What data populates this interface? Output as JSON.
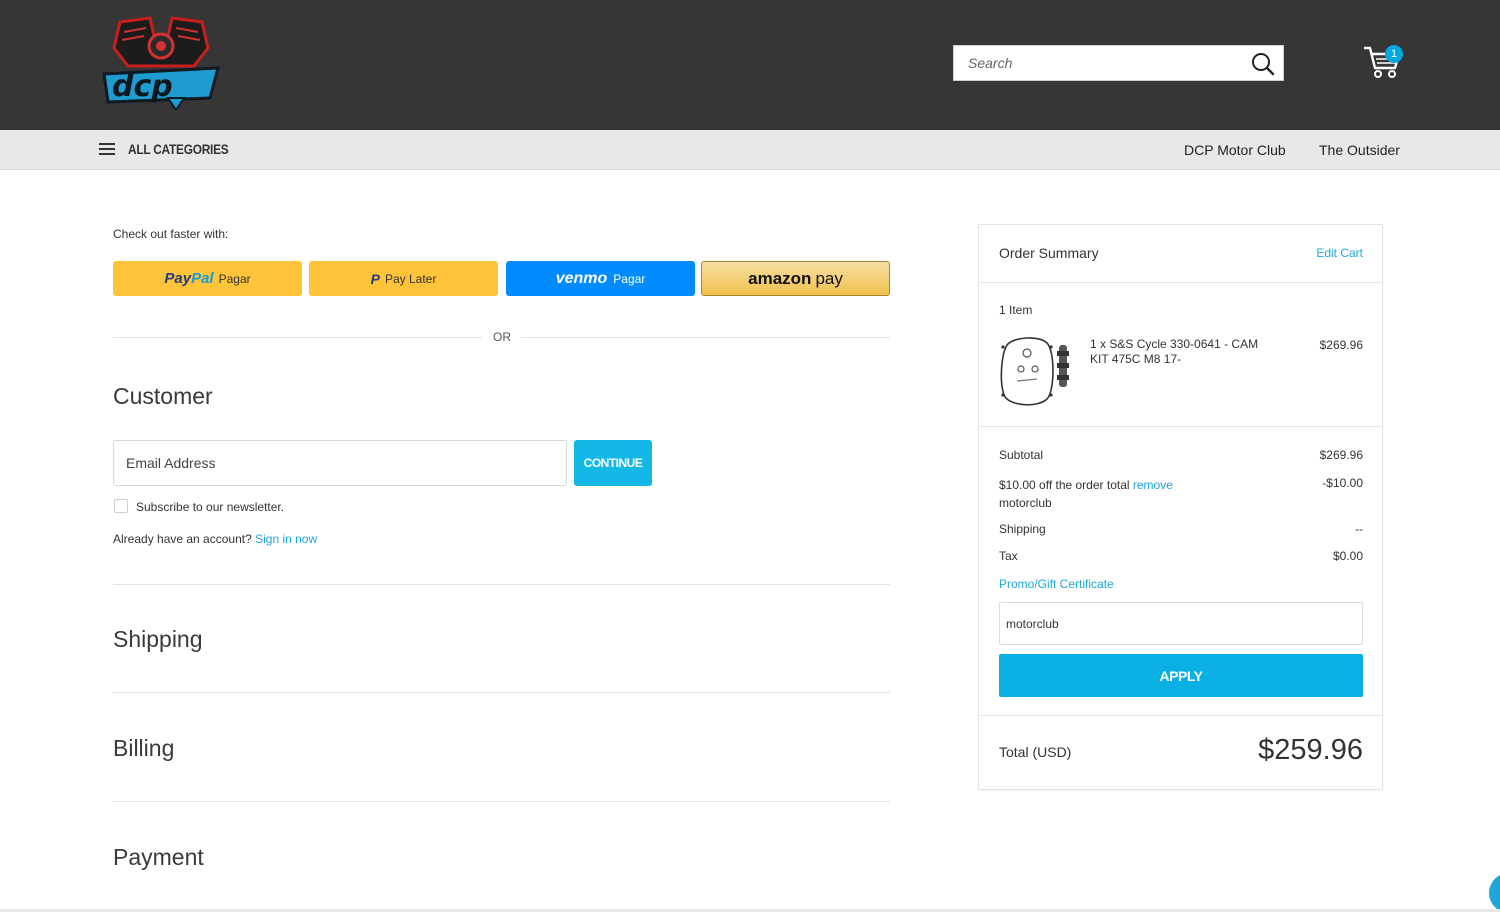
{
  "header": {
    "search_placeholder": "Search",
    "cart_count": "1"
  },
  "nav": {
    "all_categories": "ALL CATEGORIES",
    "links": [
      "DCP Motor Club",
      "The Outsider"
    ]
  },
  "checkout": {
    "faster_label": "Check out faster with:",
    "paypal": {
      "brand_a": "Pay",
      "brand_b": "Pal",
      "action": "Pagar"
    },
    "paylater": {
      "glyph": "P",
      "label": "Pay Later"
    },
    "venmo": {
      "brand": "venmo",
      "action": "Pagar"
    },
    "amazon": {
      "brand": "amazon",
      "action": "pay"
    },
    "or": "OR",
    "customer_heading": "Customer",
    "email_placeholder": "Email Address",
    "continue_label": "CONTINUE",
    "newsletter_label": "Subscribe to our newsletter.",
    "account_prompt": "Already have an account?",
    "signin_link": "Sign in now",
    "shipping_heading": "Shipping",
    "billing_heading": "Billing",
    "payment_heading": "Payment"
  },
  "summary": {
    "title": "Order Summary",
    "edit_cart": "Edit Cart",
    "item_count": "1 Item",
    "item_name": "1 x S&S Cycle 330-0641 - CAM KIT 475C M8 17-",
    "item_price": "$269.96",
    "subtotal_label": "Subtotal",
    "subtotal_value": "$269.96",
    "discount_label": "$10.00 off the order total",
    "discount_remove": "remove",
    "discount_code": "motorclub",
    "discount_value": "-$10.00",
    "shipping_label": "Shipping",
    "shipping_value": "--",
    "tax_label": "Tax",
    "tax_value": "$0.00",
    "promo_link": "Promo/Gift Certificate",
    "promo_value": "motorclub",
    "apply_label": "APPLY",
    "total_label": "Total (USD)",
    "total_value": "$259.96"
  },
  "colors": {
    "header_bg": "#363636",
    "accent": "#0ab0e4",
    "paypal_yellow": "#ffc439",
    "venmo_blue": "#008cff"
  }
}
